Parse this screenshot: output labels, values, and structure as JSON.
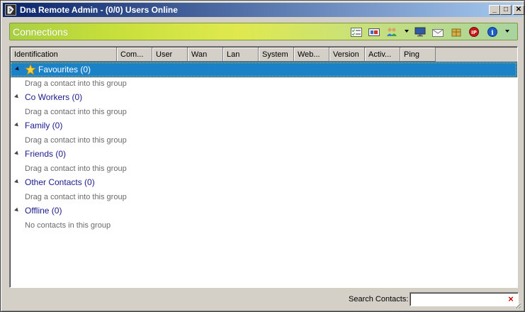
{
  "window": {
    "title": "Dna Remote Admin - (0/0) Users Online",
    "minimize": "_",
    "maximize": "□",
    "close": "✕"
  },
  "connections_bar": {
    "title": "Connections",
    "toolbar_icons": [
      "list-check-icon",
      "device-icon",
      "users-icon",
      "monitor-icon",
      "mail-icon",
      "package-icon",
      "ip-icon",
      "info-icon"
    ]
  },
  "list": {
    "columns": [
      "Identification",
      "Com...",
      "User",
      "Wan",
      "Lan",
      "System",
      "Web...",
      "Version",
      "Activ...",
      "Ping"
    ],
    "groups": [
      {
        "label": "Favourites (0)",
        "hint": "Drag a contact into this group"
      },
      {
        "label": "Co Workers (0)",
        "hint": "Drag a contact into this group"
      },
      {
        "label": "Family (0)",
        "hint": "Drag a contact into this group"
      },
      {
        "label": "Friends (0)",
        "hint": "Drag a contact into this group"
      },
      {
        "label": "Other Contacts (0)",
        "hint": "Drag a contact into this group"
      },
      {
        "label": "Offline (0)",
        "hint": "No contacts in this group"
      }
    ]
  },
  "search": {
    "label": "Search Contacts:",
    "value": "",
    "clear": "×"
  },
  "colors": {
    "title_bar_start": "#0a246a",
    "selection": "#1c82c8",
    "group_text": "#1a1a8c",
    "clear_x": "#d00000"
  }
}
